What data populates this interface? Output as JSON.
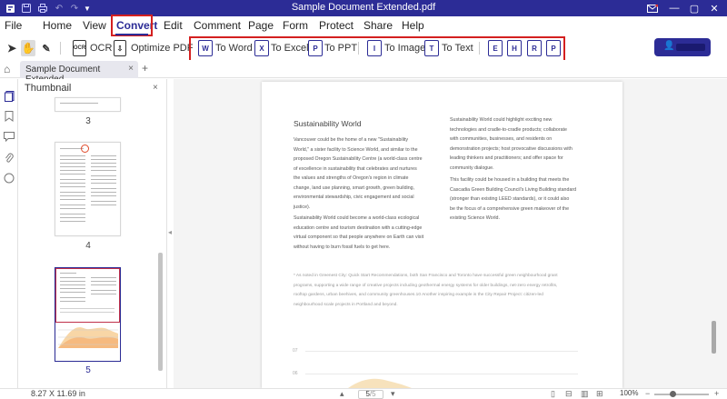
{
  "window": {
    "title": "Sample Document Extended.pdf",
    "quick_icons": [
      "app-logo-icon",
      "save-icon",
      "print-icon",
      "undo-icon",
      "redo-icon",
      "quick-access-dropdown-icon"
    ],
    "controls": [
      "mail-icon",
      "minimize-icon",
      "maximize-icon",
      "close-icon"
    ]
  },
  "menu": {
    "items": [
      "File",
      "Home",
      "View",
      "Convert",
      "Edit",
      "Comment",
      "Page",
      "Form",
      "Protect",
      "Share",
      "Help"
    ],
    "active": "Convert"
  },
  "toolbar": {
    "tools_left": [
      "select-cursor-icon",
      "hand-tool-icon",
      "edit-tool-icon"
    ],
    "ocr_label": "OCR",
    "optimize_label": "Optimize PDF",
    "convert_buttons": [
      "To Word",
      "To Excel",
      "To PPT",
      "To Image",
      "To Text"
    ],
    "convert_icon_labels": [
      "W",
      "X",
      "P",
      "I",
      "T"
    ],
    "format_icon_labels": [
      "E",
      "H",
      "R",
      "P"
    ],
    "user_name": ""
  },
  "tabs": {
    "document_tab": "Sample Document Extended",
    "close_glyph": "×",
    "add_glyph": "+"
  },
  "sidebar": {
    "rail": [
      "page-thumbnail-icon",
      "bookmark-icon",
      "comment-icon",
      "attachment-icon",
      "search-icon"
    ],
    "panel_title": "Thumbnail",
    "close_glyph": "×",
    "thumbnails": [
      {
        "page": "3",
        "selected": false
      },
      {
        "page": "4",
        "selected": false
      },
      {
        "page": "5",
        "selected": true
      }
    ]
  },
  "document": {
    "heading": "Sustainability World",
    "col1_para1": [
      "Vancouver could be the home of a new \"Sustainability",
      "World,\" a sister facility to Science World, and similar to the",
      "proposed Oregon Sustainability Centre (a world-class centre",
      "of excellence in sustainability that celebrates and nurtures",
      "the values and strengths of Oregon's region in climate",
      "change, land use planning, smart growth, green building,",
      "environmental stewardship, civic engagement and social",
      "justice)."
    ],
    "col1_para2": [
      "Sustainability World could become a world-class ecological",
      "education centre and tourism destination with a cutting-edge",
      "virtual component so that people anywhere on Earth can visit",
      "without having to burn fossil fuels to get here."
    ],
    "col2_para1": [
      "Sustainability World could highlight exciting new",
      "technologies and cradle-to-cradle products; collaborate",
      "with communities, businesses, and residents on",
      "demonstration projects; host provocative discussions with",
      "leading thinkers and practitioners; and offer space for",
      "community dialogue."
    ],
    "col2_para2": [
      "This facility could be housed in a building that meets the",
      "Cascadia Green Building Council's Living Building standard",
      "(stronger than existing LEED standards), or it could also",
      "be the focus of a comprehensive green makeover of the",
      "existing Science World."
    ],
    "footnote": [
      "* As noted in Greenest City: Quick Start Recommendations, both San Francisco and Toronto have successful green neighbourhood grant",
      "programs, supporting a wide range of creative projects including geothermal energy systems for older buildings, net-zero energy retrofits,",
      "rooftop gardens, urban beehives, and community greenhouses.10 Another inspiring example is the City Repair Project: citizen-led",
      "neighbourhood scale projects in Portland and beyond."
    ],
    "chart_ticks": [
      "07",
      "06"
    ]
  },
  "status": {
    "page_size": "8.27 X 11.69 in",
    "current_page": "5",
    "page_count": "/5",
    "zoom": "100%"
  }
}
